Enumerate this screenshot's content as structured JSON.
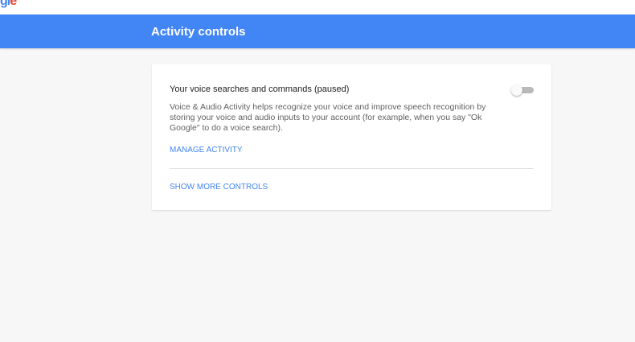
{
  "logo": {
    "part1": "g",
    "part2": "l",
    "part3": "e"
  },
  "header": {
    "title": "Activity controls"
  },
  "card": {
    "setting_title": "Your voice searches and commands (paused)",
    "setting_description": "Voice & Audio Activity helps recognize your voice and improve speech recognition by storing your voice and audio inputs to your account (for example, when you say \"Ok Google\" to do a voice search).",
    "manage_link": "MANAGE ACTIVITY",
    "show_more_link": "SHOW MORE CONTROLS",
    "toggle": {
      "state": "off"
    }
  },
  "colors": {
    "header_background": "#4285f4",
    "page_background": "#f7f7f7",
    "link": "#4285f4",
    "toggle_track_off": "#b9b9b9"
  }
}
